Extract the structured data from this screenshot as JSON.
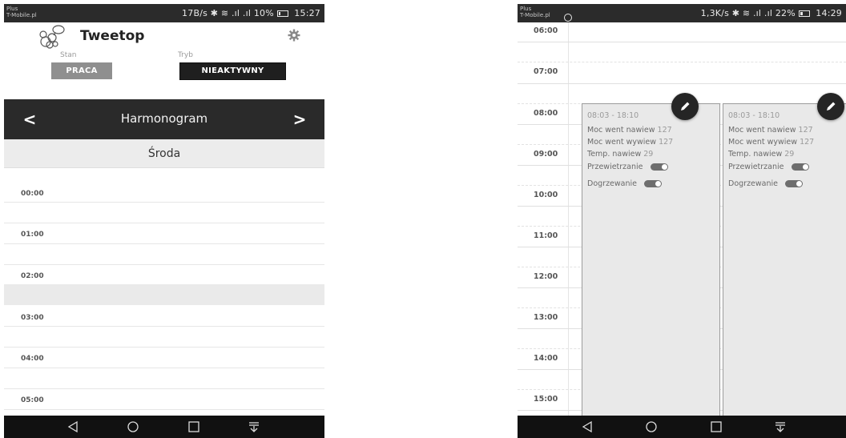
{
  "left_screen": {
    "status_bar": {
      "carrier_line1": "Plus",
      "carrier_line2": "T-Mobile.pl",
      "speed": "17B/s",
      "battery": "10%",
      "clock": "15:27"
    },
    "header": {
      "title": "Tweetop",
      "stan_label": "Stan",
      "tryb_label": "Tryb",
      "stan_value": "PRACA",
      "tryb_value": "NIEAKTYWNY"
    },
    "navbar": {
      "prev": "<",
      "title": "Harmonogram",
      "next": ">"
    },
    "day": "Środa",
    "hours": [
      "00:00",
      "01:00",
      "02:00",
      "03:00",
      "04:00",
      "05:00"
    ]
  },
  "right_screen": {
    "status_bar": {
      "carrier_line1": "Plus",
      "carrier_line2": "T-Mobile.pl",
      "speed": "1,3K/s",
      "battery": "22%",
      "clock": "14:29"
    },
    "hours": [
      "06:00",
      "07:00",
      "08:00",
      "09:00",
      "10:00",
      "11:00",
      "12:00",
      "13:00",
      "14:00",
      "15:00"
    ],
    "events": [
      {
        "time_range": "08:03 - 18:10",
        "moc_nawiew_label": "Moc went nawiew",
        "moc_nawiew_value": "127",
        "moc_wywiew_label": "Moc went wywiew",
        "moc_wywiew_value": "127",
        "temp_label": "Temp. nawiew",
        "temp_value": "29",
        "przewietrzanie_label": "Przewietrzanie",
        "dogrzewanie_label": "Dogrzewanie"
      },
      {
        "time_range": "08:03 - 18:10",
        "moc_nawiew_label": "Moc went nawiew",
        "moc_nawiew_value": "127",
        "moc_wywiew_label": "Moc went wywiew",
        "moc_wywiew_value": "127",
        "temp_label": "Temp. nawiew",
        "temp_value": "29",
        "przewietrzanie_label": "Przewietrzanie",
        "dogrzewanie_label": "Dogrzewanie"
      }
    ]
  },
  "icons": {
    "logo": "tweetop-logo-icon",
    "settings": "gear-icon",
    "back": "triangle-back-icon",
    "home": "circle-home-icon",
    "recents": "square-recents-icon",
    "notifications": "pull-down-icon",
    "edit": "pencil-icon",
    "toggle": "toggle-switch-icon"
  },
  "colors": {
    "dark_bar": "#2a2a2a",
    "praca_button": "#8f8f8f",
    "nieaktywny_button": "#1f1f1f",
    "event_bg": "#e9e9e9",
    "fab": "#252525"
  }
}
